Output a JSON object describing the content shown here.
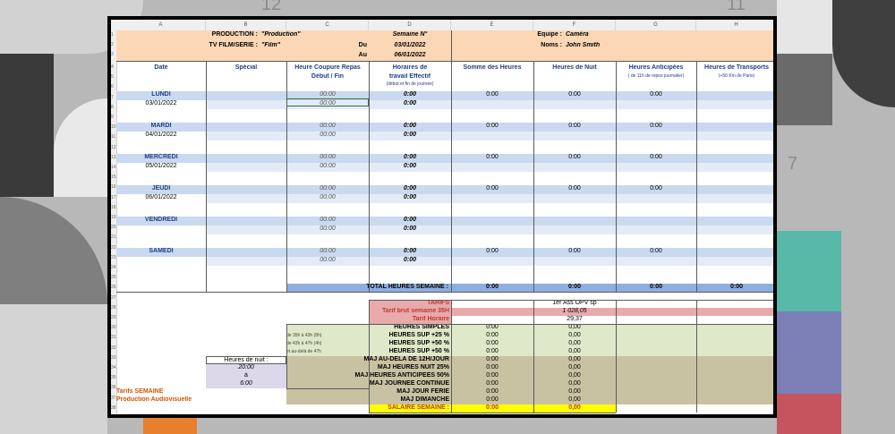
{
  "background": {
    "corner_numbers": [
      "12",
      "11",
      "7"
    ]
  },
  "columns": [
    "A",
    "B",
    "C",
    "D",
    "E",
    "F",
    "G",
    "H"
  ],
  "rows": [
    "1",
    "2",
    "3",
    "4",
    "5",
    "6",
    "7",
    "8",
    "9",
    "10",
    "11",
    "12",
    "13",
    "14",
    "15",
    "16",
    "17",
    "18",
    "19",
    "20",
    "21",
    "22",
    "23",
    "24",
    "25",
    "26",
    "27",
    "28",
    "29",
    "30",
    "31",
    "32",
    "33",
    "34",
    "35",
    "36",
    "37",
    "38"
  ],
  "header": {
    "production_label": "PRODUCTION :",
    "production_value": "\"Production\"",
    "film_label": "TV FILM/SERIE :",
    "film_value": "\"Film\"",
    "semaine_label": "Semaine N°",
    "du_label": "Du",
    "du_value": "03/01/2022",
    "au_label": "Au",
    "au_value": "06/01/2022",
    "equipe_label": "Equipe :",
    "equipe_value": "Caméra",
    "noms_label": "Noms :",
    "noms_value": "John Smith"
  },
  "col_headers": {
    "date": "Date",
    "special": "Spécial",
    "coupure": "Heure Coupure Repas",
    "coupure_sub": "Début / Fin",
    "horaires": "Horaires de",
    "horaires2": "travail Effectif",
    "horaires_sub": "(début et fin de journée)",
    "somme": "Somme des Heures",
    "nuit": "Heures de Nuit",
    "anticipees": "Heures Anticipées",
    "anticipees_sub": "( de 11h de repos journalier)",
    "transports": "Heures de Transports",
    "transports_sub": "(+50 Km de Paris)"
  },
  "days": [
    {
      "name": "LUNDI",
      "date": "03/01/2022",
      "c1": "00:00",
      "c2": "00:00",
      "d1": "0:00",
      "d2": "0:00",
      "e": "0:00",
      "f": "0:00",
      "g": "0:00"
    },
    {
      "name": "MARDI",
      "date": "04/01/2022",
      "c1": "00:00",
      "c2": "00:00",
      "d1": "0:00",
      "d2": "0:00",
      "e": "0:00",
      "f": "0:00",
      "g": "0:00"
    },
    {
      "name": "MERCREDI",
      "date": "05/01/2022",
      "c1": "00:00",
      "c2": "00:00",
      "d1": "0:00",
      "d2": "0:00",
      "e": "0:00",
      "f": "0:00",
      "g": "0:00"
    },
    {
      "name": "JEUDI",
      "date": "06/01/2022",
      "c1": "00:00",
      "c2": "00:00",
      "d1": "0:00",
      "d2": "0:00",
      "e": "0:00",
      "f": "0:00",
      "g": "0:00"
    },
    {
      "name": "VENDREDI",
      "date": "",
      "c1": "00:00",
      "c2": "00:00",
      "d1": "0:00",
      "d2": "0:00",
      "e": "",
      "f": "",
      "g": ""
    },
    {
      "name": "SAMEDI",
      "date": "",
      "c1": "00:00",
      "c2": "00:00",
      "d1": "0:00",
      "d2": "0:00",
      "e": "0:00",
      "f": "0:00",
      "g": "0:00"
    }
  ],
  "total": {
    "label": "TOTAL HEURES SEMAINE :",
    "e": "0:00",
    "f": "0:00",
    "g": "0:00",
    "h": "0:00"
  },
  "tarifs": {
    "label": "TARIFS",
    "role": "1er Ass OPV sp",
    "brut_label": "Tarif brut semaine 35H",
    "brut_value": "1 028,05",
    "horaire_label": "Tarif Horaire",
    "horaire_value": "29,37"
  },
  "lines": [
    {
      "note": "",
      "label": "HEURES SIMPLES",
      "e": "0:00",
      "f": "0,00",
      "color": "green"
    },
    {
      "note": "de 35h à 43h (8h)",
      "label": "HEURES SUP +25 %",
      "e": "0:00",
      "f": "0,00",
      "color": "green"
    },
    {
      "note": "de 43h à 47h (4h)",
      "label": "HEURES SUP +50 %",
      "e": "0:00",
      "f": "0,00",
      "color": "green"
    },
    {
      "note": "et au-delà de 47h",
      "label": "HEURES SUP +50 %",
      "e": "0:00",
      "f": "0,00",
      "color": "green"
    },
    {
      "note": "",
      "label": "MAJ AU-DELA DE 12H/JOUR",
      "e": "0:00",
      "f": "0,00",
      "color": "olive"
    },
    {
      "note": "",
      "label": "MAJ HEURES NUIT 25%",
      "e": "0:00",
      "f": "0,00",
      "color": "olive"
    },
    {
      "note": "",
      "label": "MAJ HEURES ANTICIPEES 50%",
      "e": "0:00",
      "f": "0,00",
      "color": "olive"
    },
    {
      "note": "",
      "label": "MAJ JOURNEE CONTINUE",
      "e": "0:00",
      "f": "0,00",
      "color": "olive"
    },
    {
      "note": "",
      "label": "MAJ JOUR FERIE",
      "e": "0:00",
      "f": "0,00",
      "color": "olive"
    },
    {
      "note": "",
      "label": "MAJ DIMANCHE",
      "e": "0:00",
      "f": "0,00",
      "color": "olive"
    }
  ],
  "salaire": {
    "label": "SALAIRE SEMAINE :",
    "e": "0:00",
    "f": "0,00"
  },
  "nuit_box": {
    "title": "Heures de nuit :",
    "start": "20:00",
    "sep": "à",
    "end": "6:00"
  },
  "footer": {
    "tarifs": "Tarifs SEMAINE",
    "prod": "Production Audiovisuelle"
  }
}
